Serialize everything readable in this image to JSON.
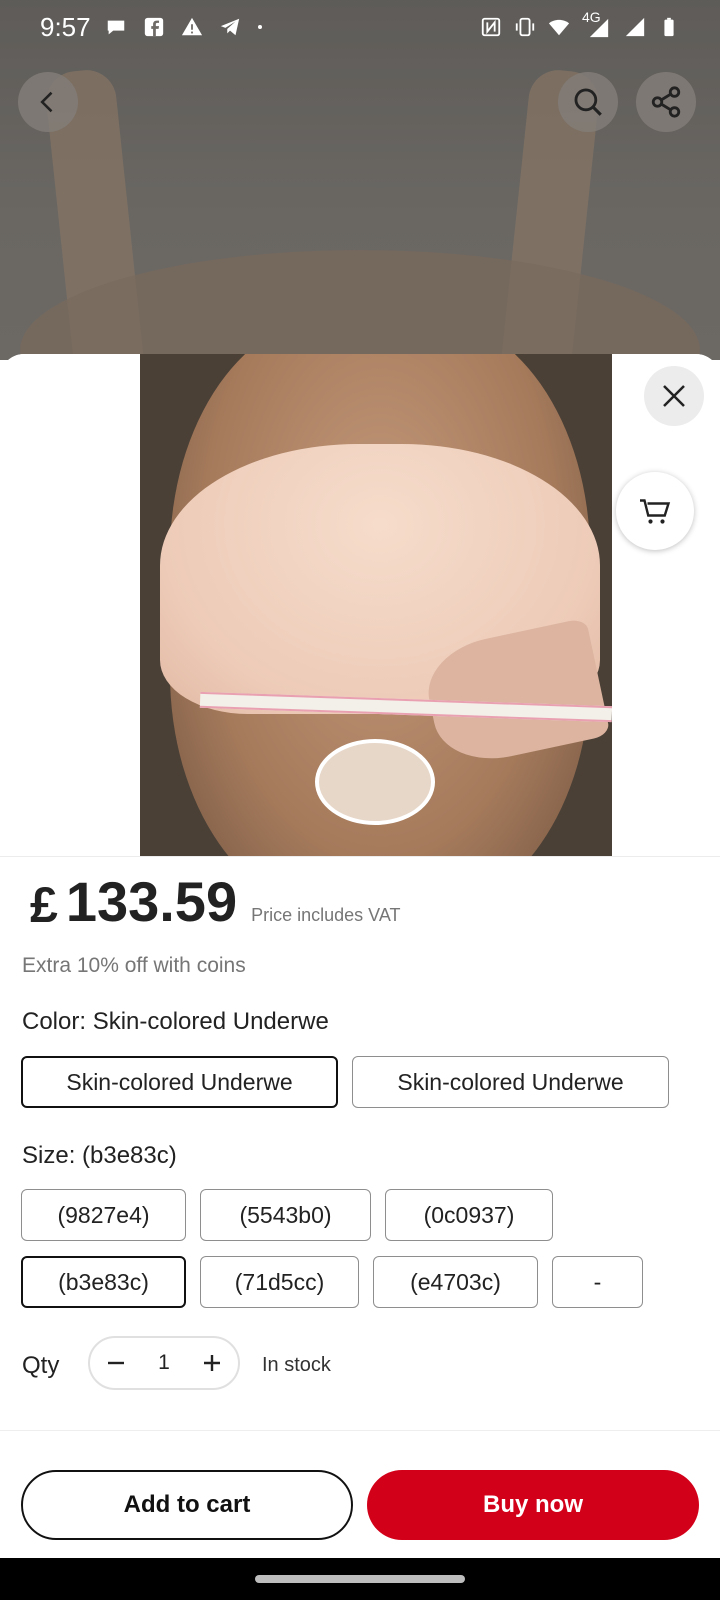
{
  "status_bar": {
    "time": "9:57",
    "network_label": "4G",
    "icons_left": [
      "chat-bubble-icon",
      "facebook-icon",
      "warning-icon",
      "telegram-icon",
      "dot-icon"
    ],
    "icons_right": [
      "nfc-icon",
      "vibrate-icon",
      "wifi-icon",
      "signal-icon",
      "signal-icon",
      "battery-icon"
    ]
  },
  "product": {
    "currency_symbol": "£",
    "price": "133.59",
    "vat_note": "Price includes VAT",
    "coins_note": "Extra 10% off with coins"
  },
  "color": {
    "label": "Color: Skin-colored Underwe",
    "options": [
      {
        "label": "Skin-colored Underwe",
        "selected": true
      },
      {
        "label": "Skin-colored Underwe",
        "selected": false
      }
    ]
  },
  "size": {
    "label": "Size: (b3e83c)",
    "options": [
      {
        "label": "(9827e4)",
        "selected": false
      },
      {
        "label": "(5543b0)",
        "selected": false
      },
      {
        "label": "(0c0937)",
        "selected": false
      },
      {
        "label": "(b3e83c)",
        "selected": true
      },
      {
        "label": "(71d5cc)",
        "selected": false
      },
      {
        "label": "(e4703c)",
        "selected": false
      },
      {
        "label": "-",
        "selected": false
      }
    ]
  },
  "quantity": {
    "label": "Qty",
    "value": "1",
    "stock_status": "In stock"
  },
  "actions": {
    "add_to_cart": "Add to cart",
    "buy_now": "Buy now"
  },
  "colors": {
    "accent": "#d30019",
    "text": "#222222",
    "muted": "#767676"
  }
}
